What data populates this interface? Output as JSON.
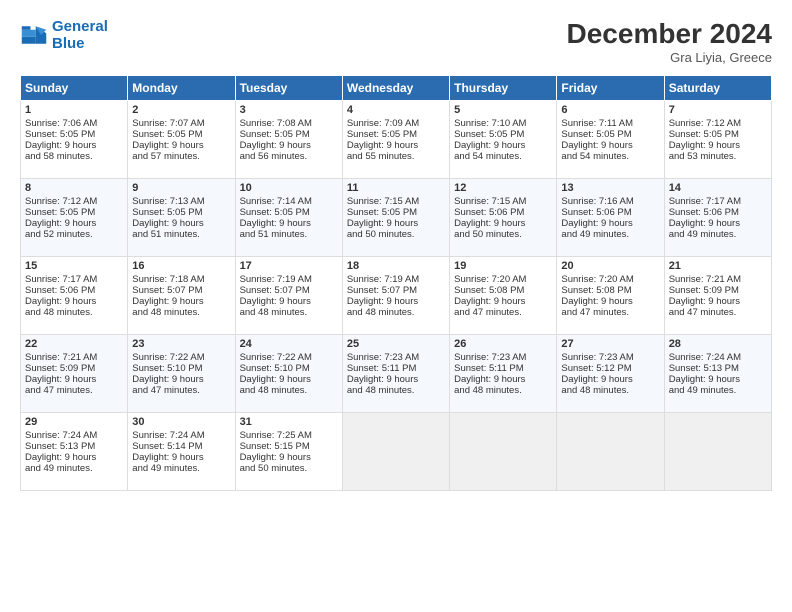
{
  "header": {
    "logo_line1": "General",
    "logo_line2": "Blue",
    "month": "December 2024",
    "location": "Gra Liyia, Greece"
  },
  "days": [
    "Sunday",
    "Monday",
    "Tuesday",
    "Wednesday",
    "Thursday",
    "Friday",
    "Saturday"
  ],
  "cells": [
    {
      "day": 1,
      "sunrise": "7:06 AM",
      "sunset": "5:05 PM",
      "daylight": "9 hours and 58 minutes."
    },
    {
      "day": 2,
      "sunrise": "7:07 AM",
      "sunset": "5:05 PM",
      "daylight": "9 hours and 57 minutes."
    },
    {
      "day": 3,
      "sunrise": "7:08 AM",
      "sunset": "5:05 PM",
      "daylight": "9 hours and 56 minutes."
    },
    {
      "day": 4,
      "sunrise": "7:09 AM",
      "sunset": "5:05 PM",
      "daylight": "9 hours and 55 minutes."
    },
    {
      "day": 5,
      "sunrise": "7:10 AM",
      "sunset": "5:05 PM",
      "daylight": "9 hours and 54 minutes."
    },
    {
      "day": 6,
      "sunrise": "7:11 AM",
      "sunset": "5:05 PM",
      "daylight": "9 hours and 54 minutes."
    },
    {
      "day": 7,
      "sunrise": "7:12 AM",
      "sunset": "5:05 PM",
      "daylight": "9 hours and 53 minutes."
    },
    {
      "day": 8,
      "sunrise": "7:12 AM",
      "sunset": "5:05 PM",
      "daylight": "9 hours and 52 minutes."
    },
    {
      "day": 9,
      "sunrise": "7:13 AM",
      "sunset": "5:05 PM",
      "daylight": "9 hours and 51 minutes."
    },
    {
      "day": 10,
      "sunrise": "7:14 AM",
      "sunset": "5:05 PM",
      "daylight": "9 hours and 51 minutes."
    },
    {
      "day": 11,
      "sunrise": "7:15 AM",
      "sunset": "5:05 PM",
      "daylight": "9 hours and 50 minutes."
    },
    {
      "day": 12,
      "sunrise": "7:15 AM",
      "sunset": "5:06 PM",
      "daylight": "9 hours and 50 minutes."
    },
    {
      "day": 13,
      "sunrise": "7:16 AM",
      "sunset": "5:06 PM",
      "daylight": "9 hours and 49 minutes."
    },
    {
      "day": 14,
      "sunrise": "7:17 AM",
      "sunset": "5:06 PM",
      "daylight": "9 hours and 49 minutes."
    },
    {
      "day": 15,
      "sunrise": "7:17 AM",
      "sunset": "5:06 PM",
      "daylight": "9 hours and 48 minutes."
    },
    {
      "day": 16,
      "sunrise": "7:18 AM",
      "sunset": "5:07 PM",
      "daylight": "9 hours and 48 minutes."
    },
    {
      "day": 17,
      "sunrise": "7:19 AM",
      "sunset": "5:07 PM",
      "daylight": "9 hours and 48 minutes."
    },
    {
      "day": 18,
      "sunrise": "7:19 AM",
      "sunset": "5:07 PM",
      "daylight": "9 hours and 48 minutes."
    },
    {
      "day": 19,
      "sunrise": "7:20 AM",
      "sunset": "5:08 PM",
      "daylight": "9 hours and 47 minutes."
    },
    {
      "day": 20,
      "sunrise": "7:20 AM",
      "sunset": "5:08 PM",
      "daylight": "9 hours and 47 minutes."
    },
    {
      "day": 21,
      "sunrise": "7:21 AM",
      "sunset": "5:09 PM",
      "daylight": "9 hours and 47 minutes."
    },
    {
      "day": 22,
      "sunrise": "7:21 AM",
      "sunset": "5:09 PM",
      "daylight": "9 hours and 47 minutes."
    },
    {
      "day": 23,
      "sunrise": "7:22 AM",
      "sunset": "5:10 PM",
      "daylight": "9 hours and 47 minutes."
    },
    {
      "day": 24,
      "sunrise": "7:22 AM",
      "sunset": "5:10 PM",
      "daylight": "9 hours and 48 minutes."
    },
    {
      "day": 25,
      "sunrise": "7:23 AM",
      "sunset": "5:11 PM",
      "daylight": "9 hours and 48 minutes."
    },
    {
      "day": 26,
      "sunrise": "7:23 AM",
      "sunset": "5:11 PM",
      "daylight": "9 hours and 48 minutes."
    },
    {
      "day": 27,
      "sunrise": "7:23 AM",
      "sunset": "5:12 PM",
      "daylight": "9 hours and 48 minutes."
    },
    {
      "day": 28,
      "sunrise": "7:24 AM",
      "sunset": "5:13 PM",
      "daylight": "9 hours and 49 minutes."
    },
    {
      "day": 29,
      "sunrise": "7:24 AM",
      "sunset": "5:13 PM",
      "daylight": "9 hours and 49 minutes."
    },
    {
      "day": 30,
      "sunrise": "7:24 AM",
      "sunset": "5:14 PM",
      "daylight": "9 hours and 49 minutes."
    },
    {
      "day": 31,
      "sunrise": "7:25 AM",
      "sunset": "5:15 PM",
      "daylight": "9 hours and 50 minutes."
    }
  ],
  "labels": {
    "sunrise": "Sunrise:",
    "sunset": "Sunset:",
    "daylight": "Daylight:"
  }
}
